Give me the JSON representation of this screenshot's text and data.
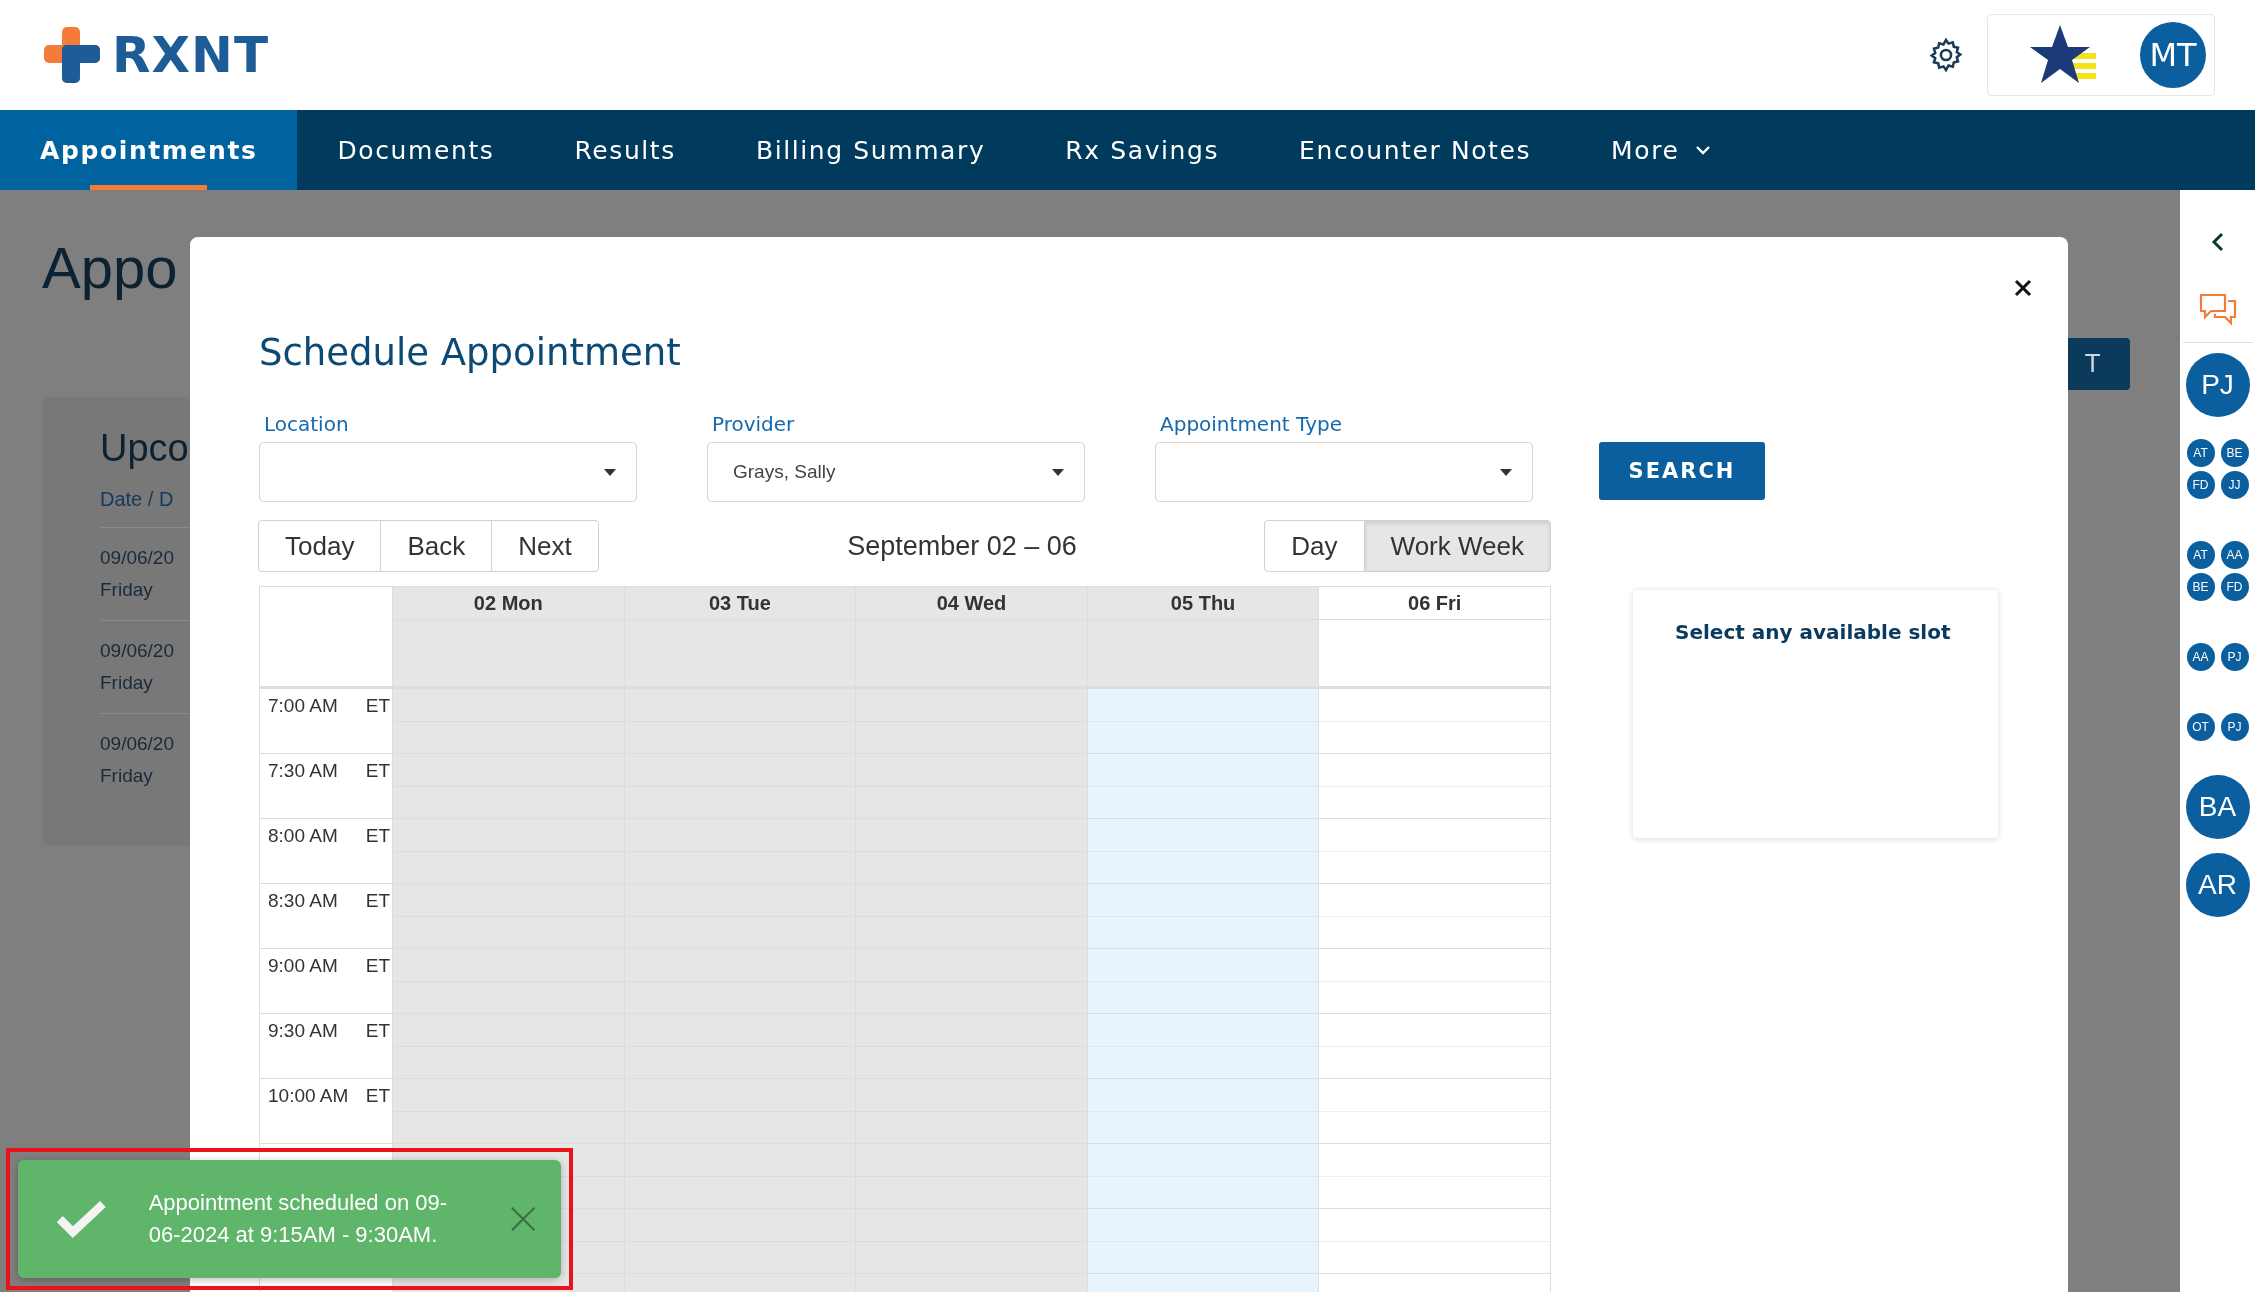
{
  "header": {
    "logo": "RXNT",
    "user_initials": "MT"
  },
  "nav": [
    {
      "label": "Appointments",
      "selected": true
    },
    {
      "label": "Documents",
      "selected": false
    },
    {
      "label": "Results",
      "selected": false
    },
    {
      "label": "Billing Summary",
      "selected": false
    },
    {
      "label": "Rx Savings",
      "selected": false
    },
    {
      "label": "Encounter Notes",
      "selected": false
    },
    {
      "label": "More",
      "selected": false,
      "dropdown": true
    }
  ],
  "background_page": {
    "title": "Appo",
    "button": "T",
    "card_title": "Upco",
    "column_header": "Date / D",
    "rows": [
      {
        "date": "09/06/20",
        "day": "Friday"
      },
      {
        "date": "09/06/20",
        "day": "Friday"
      },
      {
        "date": "09/06/20",
        "day": "Friday"
      }
    ]
  },
  "modal": {
    "title": "Schedule Appointment",
    "fields": [
      {
        "label": "Location"
      },
      {
        "label": "Provider",
        "value": "Grays, Sally"
      },
      {
        "label": "Appointment Type"
      }
    ],
    "search_button": "SEARCH",
    "nav_buttons": [
      "Today",
      "Back",
      "Next"
    ],
    "date_range": "September 02 – 06",
    "views": [
      {
        "label": "Day",
        "selected": false
      },
      {
        "label": "Work Week",
        "selected": true
      }
    ],
    "days": [
      {
        "label": "02 Mon",
        "unavailable": true,
        "today": false
      },
      {
        "label": "03 Tue",
        "unavailable": true,
        "today": false
      },
      {
        "label": "04 Wed",
        "unavailable": true,
        "today": false
      },
      {
        "label": "05 Thu",
        "unavailable": true,
        "today": true
      },
      {
        "label": "06 Fri",
        "unavailable": false,
        "today": false
      }
    ],
    "times": [
      {
        "time": "7:00 AM",
        "zone": "ET"
      },
      {
        "time": "7:30 AM",
        "zone": "ET"
      },
      {
        "time": "8:00 AM",
        "zone": "ET"
      },
      {
        "time": "8:30 AM",
        "zone": "ET"
      },
      {
        "time": "9:00 AM",
        "zone": "ET"
      },
      {
        "time": "9:30 AM",
        "zone": "ET"
      },
      {
        "time": "10:00 AM",
        "zone": "ET"
      }
    ],
    "slot_panel": "Select any available slot"
  },
  "sidebar": {
    "avatars": [
      {
        "kind": "single",
        "initials": [
          "PJ"
        ]
      },
      {
        "kind": "group",
        "initials": [
          "AT",
          "BE",
          "FD",
          "JJ"
        ]
      },
      {
        "kind": "group",
        "initials": [
          "AT",
          "AA",
          "BE",
          "FD"
        ]
      },
      {
        "kind": "group",
        "initials": [
          "AA",
          "PJ"
        ]
      },
      {
        "kind": "group",
        "initials": [
          "OT",
          "PJ"
        ]
      },
      {
        "kind": "single",
        "initials": [
          "BA"
        ]
      },
      {
        "kind": "single",
        "initials": [
          "AR"
        ]
      }
    ]
  },
  "toast": {
    "message": "Appointment scheduled on 09-06-2024 at 9:15AM - 9:30AM.",
    "highlighted": true
  }
}
